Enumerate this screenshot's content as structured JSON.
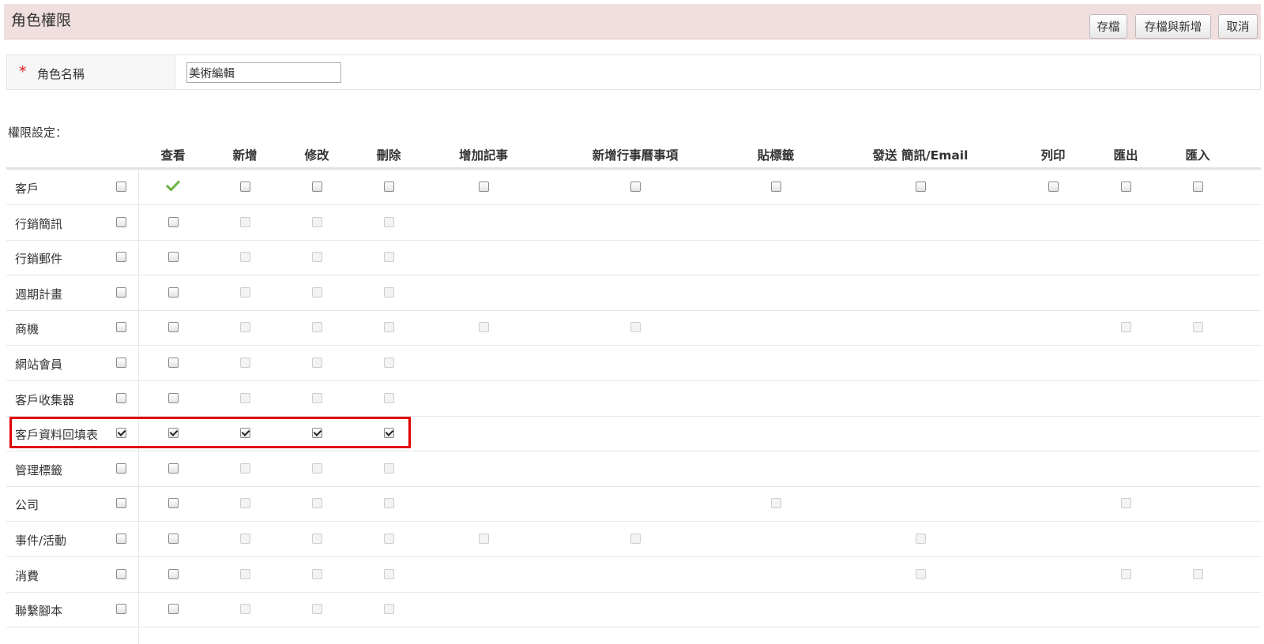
{
  "header": {
    "title": "角色權限",
    "buttons": {
      "save": "存檔",
      "save_and_new": "存檔與新增",
      "cancel": "取消"
    }
  },
  "role_name": {
    "required_mark": "*",
    "label": "角色名稱",
    "value": "美術編輯"
  },
  "permissions_title": "權限設定：",
  "columns": [
    "查看",
    "新增",
    "修改",
    "刪除",
    "增加記事",
    "新增行事曆事項",
    "貼標籤",
    "發送 簡訊/Email",
    "列印",
    "匯出",
    "匯入"
  ],
  "rows": [
    {
      "label": "客戶",
      "cells": [
        "enabled",
        "green-check",
        "enabled",
        "enabled",
        "enabled",
        "enabled",
        "enabled",
        "enabled",
        "enabled",
        "enabled",
        "enabled",
        "enabled"
      ]
    },
    {
      "label": "行銷簡訊",
      "cells": [
        "enabled",
        "enabled",
        "disabled",
        "disabled",
        "disabled",
        "none",
        "none",
        "none",
        "none",
        "none",
        "none",
        "none"
      ]
    },
    {
      "label": "行銷郵件",
      "cells": [
        "enabled",
        "enabled",
        "disabled",
        "disabled",
        "disabled",
        "none",
        "none",
        "none",
        "none",
        "none",
        "none",
        "none"
      ]
    },
    {
      "label": "週期計畫",
      "cells": [
        "enabled",
        "enabled",
        "disabled",
        "disabled",
        "disabled",
        "none",
        "none",
        "none",
        "none",
        "none",
        "none",
        "none"
      ]
    },
    {
      "label": "商機",
      "cells": [
        "enabled",
        "enabled",
        "disabled",
        "disabled",
        "disabled",
        "disabled",
        "disabled",
        "none",
        "none",
        "none",
        "disabled",
        "disabled"
      ]
    },
    {
      "label": "網站會員",
      "cells": [
        "enabled",
        "enabled",
        "disabled",
        "disabled",
        "disabled",
        "none",
        "none",
        "none",
        "none",
        "none",
        "none",
        "none"
      ]
    },
    {
      "label": "客戶收集器",
      "cells": [
        "enabled",
        "enabled",
        "disabled",
        "disabled",
        "disabled",
        "none",
        "none",
        "none",
        "none",
        "none",
        "none",
        "none"
      ]
    },
    {
      "label": "客戶資料回填表",
      "cells": [
        "checked",
        "checked",
        "checked",
        "checked",
        "checked",
        "none",
        "none",
        "none",
        "none",
        "none",
        "none",
        "none"
      ]
    },
    {
      "label": "管理標籤",
      "cells": [
        "enabled",
        "enabled",
        "disabled",
        "disabled",
        "disabled",
        "none",
        "none",
        "none",
        "none",
        "none",
        "none",
        "none"
      ]
    },
    {
      "label": "公司",
      "cells": [
        "enabled",
        "enabled",
        "disabled",
        "disabled",
        "disabled",
        "none",
        "none",
        "disabled",
        "none",
        "none",
        "disabled",
        "none"
      ]
    },
    {
      "label": "事件/活動",
      "cells": [
        "enabled",
        "enabled",
        "disabled",
        "disabled",
        "disabled",
        "disabled",
        "disabled",
        "none",
        "disabled",
        "none",
        "none",
        "none"
      ]
    },
    {
      "label": "消費",
      "cells": [
        "enabled",
        "enabled",
        "disabled",
        "disabled",
        "disabled",
        "none",
        "none",
        "none",
        "disabled",
        "none",
        "disabled",
        "disabled"
      ]
    },
    {
      "label": "聯繫腳本",
      "cells": [
        "enabled",
        "enabled",
        "disabled",
        "disabled",
        "disabled",
        "none",
        "none",
        "none",
        "none",
        "none",
        "none",
        "none"
      ]
    }
  ],
  "colors": {
    "header_bg": "#f1dede",
    "highlight": "#e00000",
    "check_green": "#6cb33f",
    "required": "#e02020"
  },
  "icons": {
    "view_granted": "green-check-icon"
  }
}
